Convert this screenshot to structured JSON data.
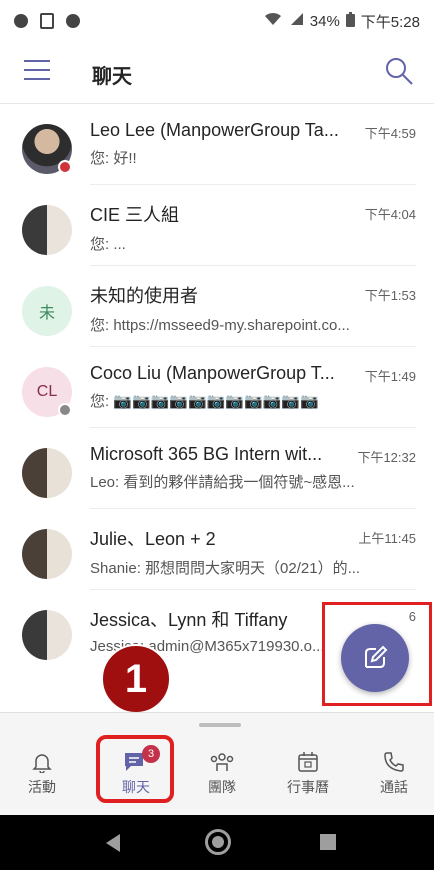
{
  "status_bar": {
    "battery_percent": "34%",
    "time": "下午5:28"
  },
  "header": {
    "title": "聊天"
  },
  "chats": [
    {
      "name": "Leo Lee (ManpowerGroup Ta...",
      "time": "下午4:59",
      "preview": "您: 好!!",
      "avatar": "photo",
      "status_color": "#d13438"
    },
    {
      "name": "CIE 三人組",
      "time": "下午4:04",
      "preview": "您: ...",
      "avatar": "group"
    },
    {
      "name": "未知的使用者",
      "time": "下午1:53",
      "preview": "您: https://msseed9-my.sharepoint.co...",
      "avatar": "initials",
      "initials": "未",
      "avatar_bg": "#dff3e6",
      "avatar_fg": "#3d8a5c"
    },
    {
      "name": "Coco Liu (ManpowerGroup T...",
      "time": "下午1:49",
      "preview": "您: 📷📷📷📷📷📷📷📷📷📷📷",
      "avatar": "initials",
      "initials": "CL",
      "avatar_bg": "#f6dfe6",
      "avatar_fg": "#8b2c4b",
      "status_color": "#8a8886"
    },
    {
      "name": "Microsoft 365 BG Intern wit...",
      "time": "下午12:32",
      "preview": "Leo: 看到的夥伴請給我一個符號~感恩...",
      "avatar": "group2"
    },
    {
      "name": "Julie、Leon + 2",
      "time": "上午11:45",
      "preview": "Shanie: 那想問問大家明天（02/21）的...",
      "avatar": "group2"
    },
    {
      "name": "Jessica、Lynn 和 Tiffany",
      "time": "6",
      "preview": "Jessica: admin@M365x719930.o...",
      "avatar": "group"
    }
  ],
  "step_marker": "1",
  "nav": {
    "items": [
      {
        "label": "活動",
        "icon": "bell-icon"
      },
      {
        "label": "聊天",
        "icon": "chat-icon",
        "badge": "3"
      },
      {
        "label": "團隊",
        "icon": "teams-icon"
      },
      {
        "label": "行事曆",
        "icon": "calendar-icon"
      },
      {
        "label": "通話",
        "icon": "phone-icon"
      }
    ]
  },
  "colors": {
    "accent": "#6264a7",
    "highlight": "#e02020",
    "step_marker": "#a00f0f"
  }
}
